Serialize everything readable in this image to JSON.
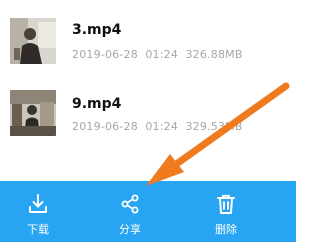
{
  "files": [
    {
      "name": "3.mp4",
      "date": "2019-06-28",
      "time": "01:24",
      "size": "326.88MB",
      "thumbnail": "video-thumbnail-icon"
    },
    {
      "name": "9.mp4",
      "date": "2019-06-28",
      "time": "01:24",
      "size": "329.53MB",
      "thumbnail": "video-thumbnail-icon"
    }
  ],
  "toolbar": {
    "download_label": "下载",
    "share_label": "分享",
    "delete_label": "删除",
    "download_icon": "download-icon",
    "share_icon": "share-icon",
    "delete_icon": "trash-icon"
  },
  "colors": {
    "toolbar_bg": "#27a4f2",
    "arrow": "#f07a1e",
    "meta_text": "#a6a6a6"
  }
}
